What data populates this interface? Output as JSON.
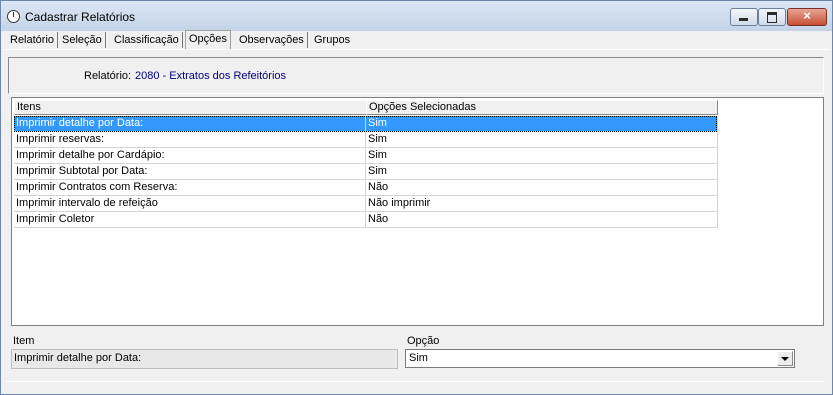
{
  "window": {
    "title": "Cadastrar Relatórios",
    "close_glyph": "×"
  },
  "tabs": [
    {
      "label": "Relatório"
    },
    {
      "label": "Seleção"
    },
    {
      "label": "Classificação"
    },
    {
      "label": "Opções",
      "active": true
    },
    {
      "label": "Observações"
    },
    {
      "label": "Grupos"
    }
  ],
  "report": {
    "label": "Relatório:",
    "value": "2080 - Extratos dos Refeitórios"
  },
  "grid": {
    "columns": [
      "Itens",
      "Opções Selecionadas"
    ],
    "rows": [
      {
        "item": "Imprimir detalhe por Data:",
        "option": "Sim",
        "selected": true
      },
      {
        "item": "Imprimir reservas:",
        "option": "Sim"
      },
      {
        "item": "Imprimir detalhe por Cardápio:",
        "option": "Sim"
      },
      {
        "item": "Imprimir Subtotal por Data:",
        "option": "Sim"
      },
      {
        "item": "Imprimir Contratos com Reserva:",
        "option": "Não"
      },
      {
        "item": "Imprimir intervalo de refeição",
        "option": "Não imprimir"
      },
      {
        "item": "Imprimir Coletor",
        "option": "Não"
      }
    ]
  },
  "editor": {
    "item_label": "Item",
    "item_value": "Imprimir detalhe por Data:",
    "option_label": "Opção",
    "option_value": "Sim"
  },
  "colors": {
    "selection": "#3399ff",
    "report_value": "#000080",
    "close_button": "#c74f36"
  }
}
